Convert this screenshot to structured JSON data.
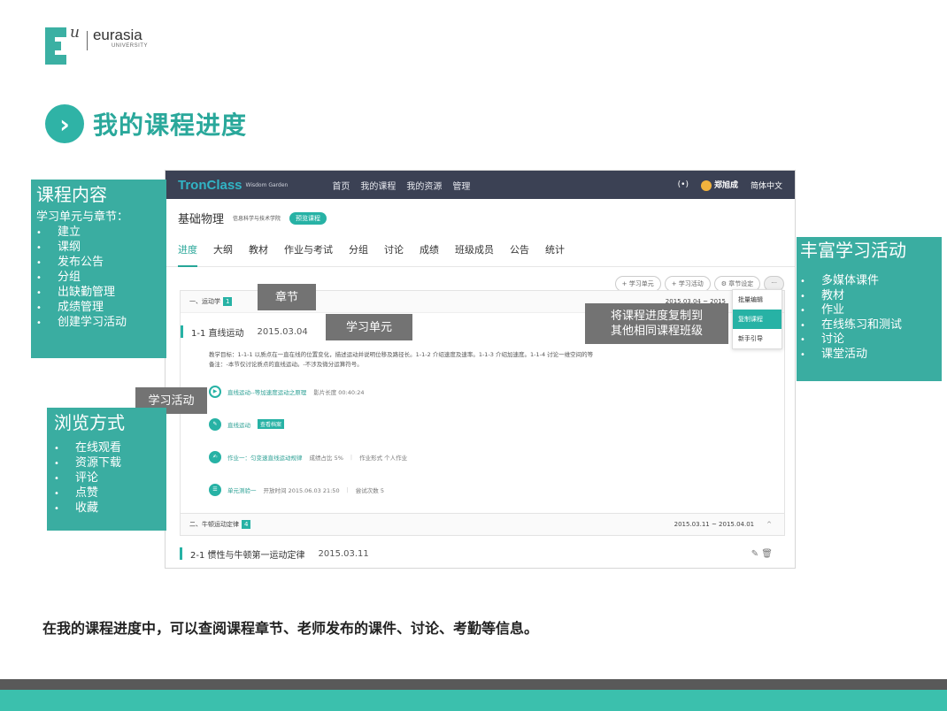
{
  "logo": {
    "letter_mark": "u",
    "name": "eurasia",
    "sub": "UNIVERSITY"
  },
  "slide_title": "我的课程进度",
  "app": {
    "brand": "TronClass",
    "brand_sub": "Wisdom Garden",
    "nav": [
      "首页",
      "我的课程",
      "我的资源",
      "管理"
    ],
    "live_icon": "(•)",
    "user": "郑旭成",
    "language": "简体中文",
    "course_name": "基础物理",
    "course_school": "信息科学与技术学院",
    "course_badge": "预览课程",
    "tabs": [
      "进度",
      "大纲",
      "教材",
      "作业与考试",
      "分组",
      "讨论",
      "成绩",
      "班级成员",
      "公告",
      "统计"
    ],
    "actions": [
      "+ 学习单元",
      "+ 学习活动",
      "⚙ 章节设定",
      "···"
    ],
    "dropdown": [
      "批量编辑",
      "复制课程",
      "新手引导"
    ],
    "chapter1": {
      "label": "一、运动学",
      "count": "1",
      "date": "2015.03.04 ~ 2015"
    },
    "unit1": {
      "title": "1-1 直线运动",
      "date": "2015.03.04",
      "desc1": "教学目标：1-1-1 以质点在一直在线的位置变化，描述运动并说明位移及路径长。1-1-2 介绍速度及速率。1-1-3 介绍加速度。1-1-4 讨论一维空间的等",
      "desc2": "备注：-本节仅讨论质点的直线运动。-不涉及微分运算符号。"
    },
    "activities": [
      {
        "icon": "▶",
        "name": "直线运动--等加速度运动之原理",
        "meta1": "影片长度 00:40:24",
        "meta2": "",
        "tag": ""
      },
      {
        "icon": "✎",
        "name": "直线运动",
        "meta1": "",
        "meta2": "",
        "tag": "查看档案"
      },
      {
        "icon": "✍",
        "name": "作业一：匀变速直线运动规律",
        "meta1": "成绩占比 5%",
        "meta2": "作业形式 个人作业",
        "tag": ""
      },
      {
        "icon": "☰",
        "name": "单元测验一",
        "meta1": "开放时间 2015.06.03 21:50",
        "meta2": "尝试次数 5",
        "tag": ""
      }
    ],
    "chapter2": {
      "label": "二、牛顿运动定律",
      "count": "4",
      "date": "2015.03.11 ~ 2015.04.01",
      "toggle": "^"
    },
    "unit2": {
      "title": "2-1 惯性与牛顿第一运动定律",
      "date": "2015.03.11",
      "icons": "✎ 🗑"
    }
  },
  "callouts": {
    "chapter": "章节",
    "unit": "学习单元",
    "activity": "学习活动",
    "copy_line1": "将课程进度复制到",
    "copy_line2": "其他相同课程班级"
  },
  "panel_content": {
    "title": "课程内容",
    "subtitle": "学习单元与章节：",
    "items": [
      "建立",
      "课纲",
      "发布公告",
      "分组",
      "出缺勤管理",
      "成绩管理",
      "创建学习活动"
    ]
  },
  "panel_browse": {
    "title": "浏览方式",
    "items": [
      "在线观看",
      "资源下载",
      "评论",
      "点赞",
      "收藏"
    ]
  },
  "panel_activities": {
    "title": "丰富学习活动",
    "items": [
      "多媒体课件",
      "教材",
      "作业",
      "在线练习和测试",
      "讨论",
      "课堂活动"
    ]
  },
  "caption": "在我的课程进度中，可以查阅课程章节、老师发布的课件、讨论、考勤等信息。",
  "colors": {
    "teal": "#3aada1",
    "dark_nav": "#3b4154",
    "callout_gray": "#737373"
  }
}
